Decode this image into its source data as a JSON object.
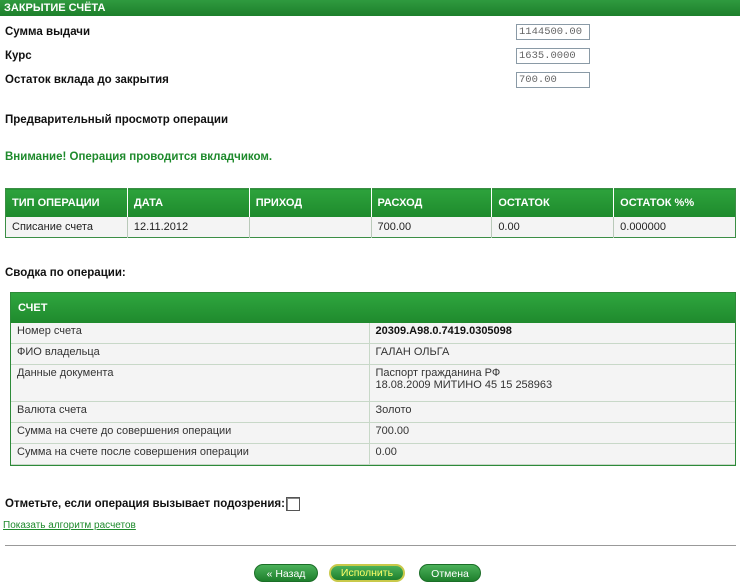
{
  "title": "ЗАКРЫТИЕ СЧЁТА",
  "fields": [
    {
      "label": "Сумма выдачи",
      "value": "1144500.00"
    },
    {
      "label": "Курс",
      "value": "1635.0000"
    },
    {
      "label": "Остаток вклада до закрытия",
      "value": "700.00"
    }
  ],
  "preview_title": "Предварительный просмотр операции",
  "warning": "Внимание! Операция проводится вкладчиком.",
  "operations": {
    "headers": [
      "ТИП ОПЕРАЦИИ",
      "ДАТА",
      "ПРИХОД",
      "РАСХОД",
      "ОСТАТОК",
      "ОСТАТОК %%"
    ],
    "row": [
      "Списание счета",
      "12.11.2012",
      "",
      "700.00",
      "0.00",
      "0.000000"
    ]
  },
  "summary": {
    "title": "Сводка по операции:",
    "header": "СЧЕТ",
    "rows": [
      {
        "label": "Номер счета",
        "value": "20309.A98.0.7419.0305098"
      },
      {
        "label": "ФИО владельца",
        "value": "ГАЛАН ОЛЬГА"
      },
      {
        "label": "Данные документа",
        "value": "Паспорт гражданина РФ",
        "value2": "18.08.2009 МИТИНО 45 15 258963"
      },
      {
        "label": "Валюта счета",
        "value": "Золото"
      },
      {
        "label": "Сумма на счете до совершения операции",
        "value": "700.00"
      },
      {
        "label": "Сумма на счете после совершения операции",
        "value": "0.00"
      }
    ]
  },
  "suspicion_label": "Отметьте, если операция вызывает подозрения:",
  "algo_link": "Показать алгоритм расчетов",
  "buttons": {
    "back": "« Назад",
    "execute": "Исполнить",
    "cancel": "Отмена"
  }
}
